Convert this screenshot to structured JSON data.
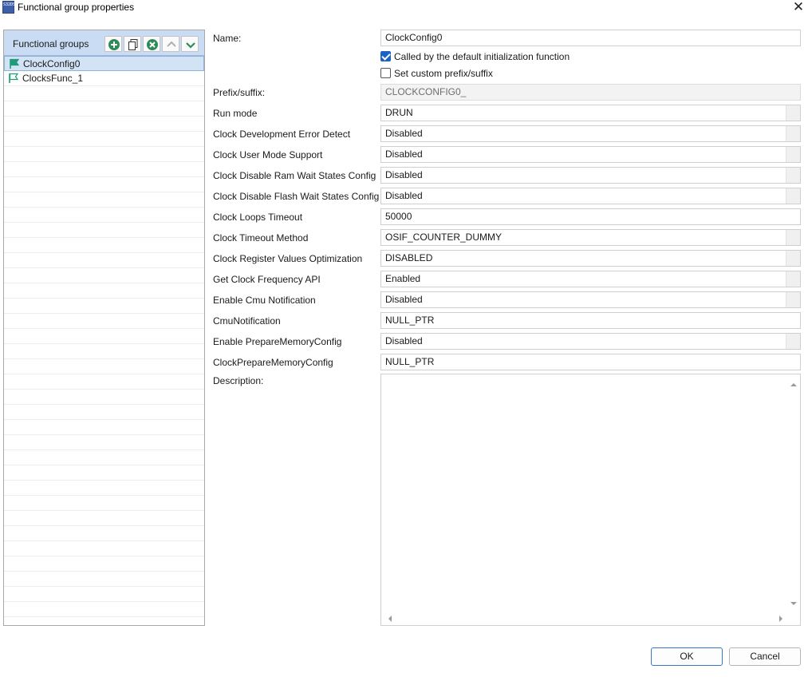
{
  "window": {
    "app_icon_text": "S32DS",
    "title": "Functional group properties"
  },
  "left_panel": {
    "header_title": "Functional groups",
    "toolbar": [
      {
        "name": "add-group-button",
        "icon": "add-circle-icon",
        "color": "#2e8b57"
      },
      {
        "name": "copy-group-button",
        "icon": "copy-icon",
        "color": "#333333"
      },
      {
        "name": "remove-group-button",
        "icon": "remove-circle-icon",
        "color": "#2e8b57"
      },
      {
        "name": "move-up-button",
        "icon": "chevron-up-icon",
        "color": "#b0b0b0"
      },
      {
        "name": "move-down-button",
        "icon": "chevron-down-icon",
        "color": "#2e8b57"
      }
    ],
    "groups": [
      {
        "label": "ClockConfig0",
        "selected": true
      },
      {
        "label": "ClocksFunc_1",
        "selected": false
      }
    ]
  },
  "form": {
    "name_label": "Name:",
    "name_value": "ClockConfig0",
    "called_by_default_label": "Called by the default initialization function",
    "called_by_default_checked": true,
    "custom_prefix_label": "Set custom prefix/suffix",
    "custom_prefix_checked": false,
    "prefix_label": "Prefix/suffix:",
    "prefix_value": "CLOCKCONFIG0_",
    "properties": [
      {
        "label": "Run mode",
        "value": "DRUN",
        "kind": "combo"
      },
      {
        "label": "Clock Development Error Detect",
        "value": "Disabled",
        "kind": "combo"
      },
      {
        "label": "Clock User Mode Support",
        "value": "Disabled",
        "kind": "combo"
      },
      {
        "label": "Clock Disable Ram Wait States Config",
        "value": "Disabled",
        "kind": "combo"
      },
      {
        "label": "Clock Disable Flash Wait States Config",
        "value": "Disabled",
        "kind": "combo"
      },
      {
        "label": "Clock Loops Timeout",
        "value": "50000",
        "kind": "text"
      },
      {
        "label": "Clock Timeout Method",
        "value": "OSIF_COUNTER_DUMMY",
        "kind": "combo"
      },
      {
        "label": "Clock Register Values Optimization",
        "value": "DISABLED",
        "kind": "combo"
      },
      {
        "label": "Get Clock Frequency API",
        "value": "Enabled",
        "kind": "combo"
      },
      {
        "label": "Enable Cmu Notification",
        "value": "Disabled",
        "kind": "combo"
      },
      {
        "label": "CmuNotification",
        "value": "NULL_PTR",
        "kind": "text"
      },
      {
        "label": "Enable PrepareMemoryConfig",
        "value": "Disabled",
        "kind": "combo"
      },
      {
        "label": "ClockPrepareMemoryConfig",
        "value": "NULL_PTR",
        "kind": "text"
      }
    ],
    "description_label": "Description:",
    "description_value": ""
  },
  "buttons": {
    "ok_label": "OK",
    "cancel_label": "Cancel"
  }
}
